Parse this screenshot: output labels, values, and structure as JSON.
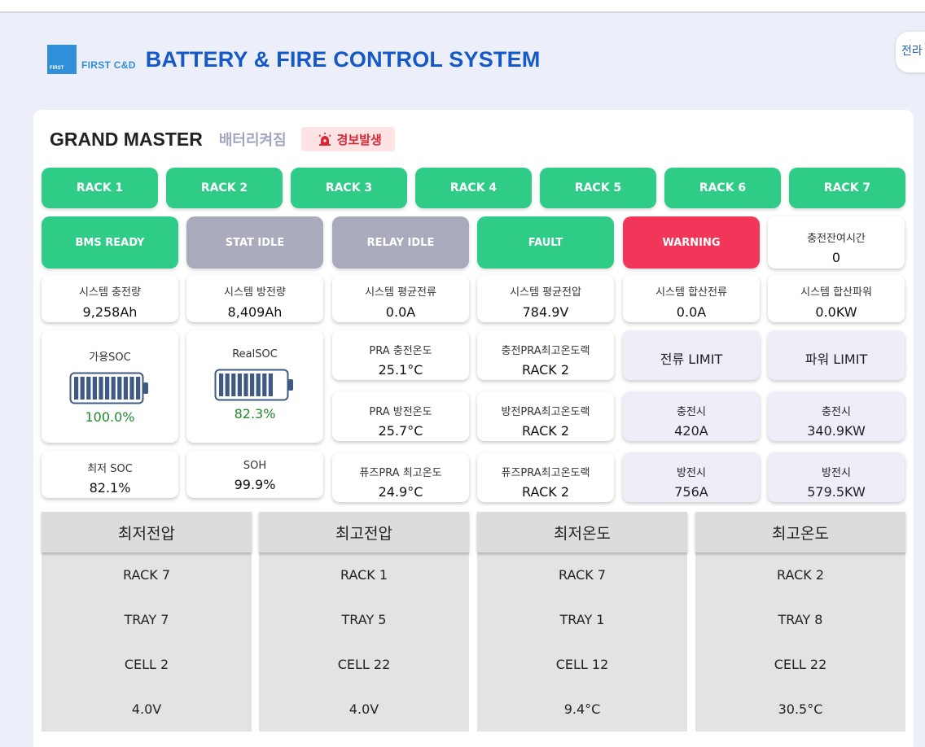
{
  "header": {
    "logo_small": "FIRST",
    "logo_text": "FIRST C&D",
    "title": "BATTERY & FIRE CONTROL SYSTEM",
    "lang_button": "전라"
  },
  "master": {
    "title": "GRAND MASTER",
    "subtitle": "배터리켜짐",
    "alarm": "경보발생",
    "alarm_icon": "siren-icon"
  },
  "racks": [
    "RACK 1",
    "RACK 2",
    "RACK 3",
    "RACK 4",
    "RACK 5",
    "RACK 6",
    "RACK 7"
  ],
  "status": {
    "bms": "BMS READY",
    "stat": "STAT IDLE",
    "relay": "RELAY IDLE",
    "fault": "FAULT",
    "warning": "WARNING",
    "charge_remaining_label": "충전잔여시간",
    "charge_remaining_value": "0"
  },
  "metrics": [
    {
      "label": "시스템 충전량",
      "value": "9,258Ah"
    },
    {
      "label": "시스템 방전량",
      "value": "8,409Ah"
    },
    {
      "label": "시스템 평균전류",
      "value": "0.0A"
    },
    {
      "label": "시스템 평균전압",
      "value": "784.9V"
    },
    {
      "label": "시스템 합산전류",
      "value": "0.0A"
    },
    {
      "label": "시스템 합산파워",
      "value": "0.0KW"
    }
  ],
  "soc": {
    "usable_label": "가용SOC",
    "usable_value": "100.0%",
    "usable_fraction": 1.0,
    "real_label": "RealSOC",
    "real_value": "82.3%",
    "real_fraction": 0.823,
    "min_label": "최저 SOC",
    "min_value": "82.1%",
    "soh_label": "SOH",
    "soh_value": "99.9%"
  },
  "temps": {
    "pra_charge_label": "PRA 충전온도",
    "pra_charge_value": "25.1°C",
    "pra_discharge_label": "PRA 방전온도",
    "pra_discharge_value": "25.7°C",
    "fuse_max_label": "퓨즈PRA 최고온도",
    "fuse_max_value": "24.9°C",
    "charge_max_rack_label": "충전PRA최고온도랙",
    "charge_max_rack_value": "RACK 2",
    "discharge_max_rack_label": "방전PRA최고온도랙",
    "discharge_max_rack_value": "RACK 2",
    "fuse_max_rack_label": "퓨즈PRA최고온도랙",
    "fuse_max_rack_value": "RACK 2"
  },
  "limits": {
    "current_title": "전류 LIMIT",
    "power_title": "파워 LIMIT",
    "charge_label": "충전시",
    "discharge_label": "방전시",
    "current_charge": "420A",
    "current_discharge": "756A",
    "power_charge": "340.9KW",
    "power_discharge": "579.5KW"
  },
  "extremes": [
    {
      "title": "최저전압",
      "rack": "RACK 7",
      "tray": "TRAY 7",
      "cell": "CELL 2",
      "value": "4.0V"
    },
    {
      "title": "최고전압",
      "rack": "RACK 1",
      "tray": "TRAY 5",
      "cell": "CELL 22",
      "value": "4.0V"
    },
    {
      "title": "최저온도",
      "rack": "RACK 7",
      "tray": "TRAY 1",
      "cell": "CELL 12",
      "value": "9.4°C"
    },
    {
      "title": "최고온도",
      "rack": "RACK 2",
      "tray": "TRAY 8",
      "cell": "CELL 22",
      "value": "30.5°C"
    }
  ],
  "colors": {
    "green": "#2ecc86",
    "grey": "#a9abbc",
    "red": "#f2365a",
    "title_blue": "#1459c7",
    "battery": "#3f5985"
  }
}
